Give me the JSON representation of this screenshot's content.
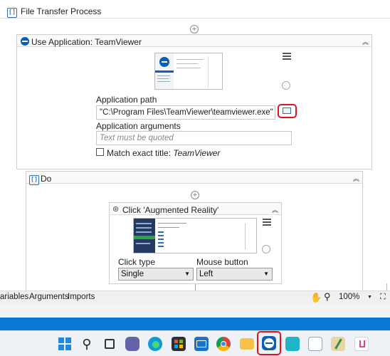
{
  "sequence": {
    "title": "File Transfer Process"
  },
  "use_app": {
    "title": "Use Application: TeamViewer",
    "app_path_label": "Application path",
    "app_path_value": "\"C:\\Program Files\\TeamViewer\\teamviewer.exe\"",
    "app_args_label": "Application arguments",
    "app_args_placeholder": "Text must be quoted",
    "match_title_label": "Match exact title:",
    "match_title_value": "TeamViewer"
  },
  "do_block": {
    "title": "Do"
  },
  "click_activity": {
    "title": "Click 'Augmented Reality'",
    "click_type_label": "Click type",
    "click_type_value": "Single",
    "mouse_button_label": "Mouse button",
    "mouse_button_value": "Left"
  },
  "bottom_bar": {
    "tabs": [
      "ariables",
      "Arguments",
      "Imports"
    ],
    "zoom": "100%"
  },
  "colors": {
    "accent": "#2d6fb7",
    "highlight": "#e0141e",
    "taskbar_band": "#0a78d7"
  }
}
